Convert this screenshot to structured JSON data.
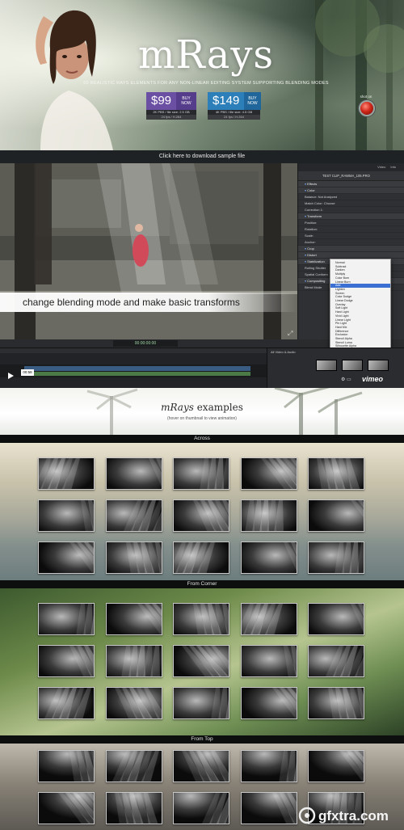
{
  "hero": {
    "logo": "mRays",
    "tagline": "60 REALISTIC RAYS ELEMENTS FOR ANY NON-LINEAR EDITING SYSTEM SUPPORTING BLENDING MODES",
    "prices": [
      {
        "amount": "$99",
        "buy": "BUY NOW",
        "meta": "2K PBS / file size: 2.5 GB",
        "meta2": "24 fps / H.264"
      },
      {
        "amount": "$149",
        "buy": "BUY NOW",
        "meta": "4K PBS / file size: 4.5 GB",
        "meta2": "24 fps / H.264"
      }
    ],
    "shot_on": "shot on"
  },
  "download_bar": "Click here to download sample file",
  "video": {
    "caption": "change blending mode and make basic transforms",
    "timecode": "00:00:00:00",
    "time_chip": "00:58",
    "inspector_tabs": [
      "Video",
      "Info"
    ],
    "clip_name": "TEST CLIP_RAWMA_105.PRO",
    "inspector_rows": [
      {
        "label": "Effects",
        "section": true
      },
      {
        "label": "Color",
        "section": true
      },
      {
        "label": "Balance:  Not Analyzed",
        "section": false
      },
      {
        "label": "Match Color:  Choose",
        "section": false
      },
      {
        "label": "Correction 1:",
        "section": false
      },
      {
        "label": "Transform",
        "section": true
      },
      {
        "label": "Position:",
        "section": false
      },
      {
        "label": "Rotation:",
        "section": false
      },
      {
        "label": "Scale:",
        "section": false
      },
      {
        "label": "Anchor:",
        "section": false
      },
      {
        "label": "Crop",
        "section": true
      },
      {
        "label": "Distort",
        "section": true
      },
      {
        "label": "Stabilization",
        "section": true
      },
      {
        "label": "Rolling Shutter",
        "section": false
      },
      {
        "label": "Spatial Conform",
        "section": false
      },
      {
        "label": "Compositing",
        "section": true
      },
      {
        "label": "Blend Mode",
        "section": false
      }
    ],
    "blend_modes": [
      "Normal",
      "Subtract",
      "Darken",
      "Multiply",
      "Color Burn",
      "Linear Burn",
      "Add",
      "Lighten",
      "Screen",
      "Color Dodge",
      "Linear Dodge",
      "Overlay",
      "Soft Light",
      "Hard Light",
      "Vivid Light",
      "Linear Light",
      "Pin Light",
      "Hard Mix",
      "Difference",
      "Exclusion",
      "Stencil Alpha",
      "Stencil Luma",
      "Silhouette Alpha",
      "Silhouette Luma",
      "Behind",
      "Alpha Add",
      "Premultiplied Mix"
    ],
    "selected_blend": "Add",
    "browser_label": "All Video & Audio",
    "vimeo": "vimeo"
  },
  "examples": {
    "title_italic": "mRays",
    "title_rest": " examples",
    "subtitle": "(hover on thumbnail to view animation)"
  },
  "sections": [
    {
      "title": "Across",
      "rows": 3,
      "cols": 5
    },
    {
      "title": "From Corner",
      "rows": 3,
      "cols": 5
    },
    {
      "title": "From Top",
      "rows": 2,
      "cols": 5
    }
  ],
  "watermark": "gfxtra.com"
}
